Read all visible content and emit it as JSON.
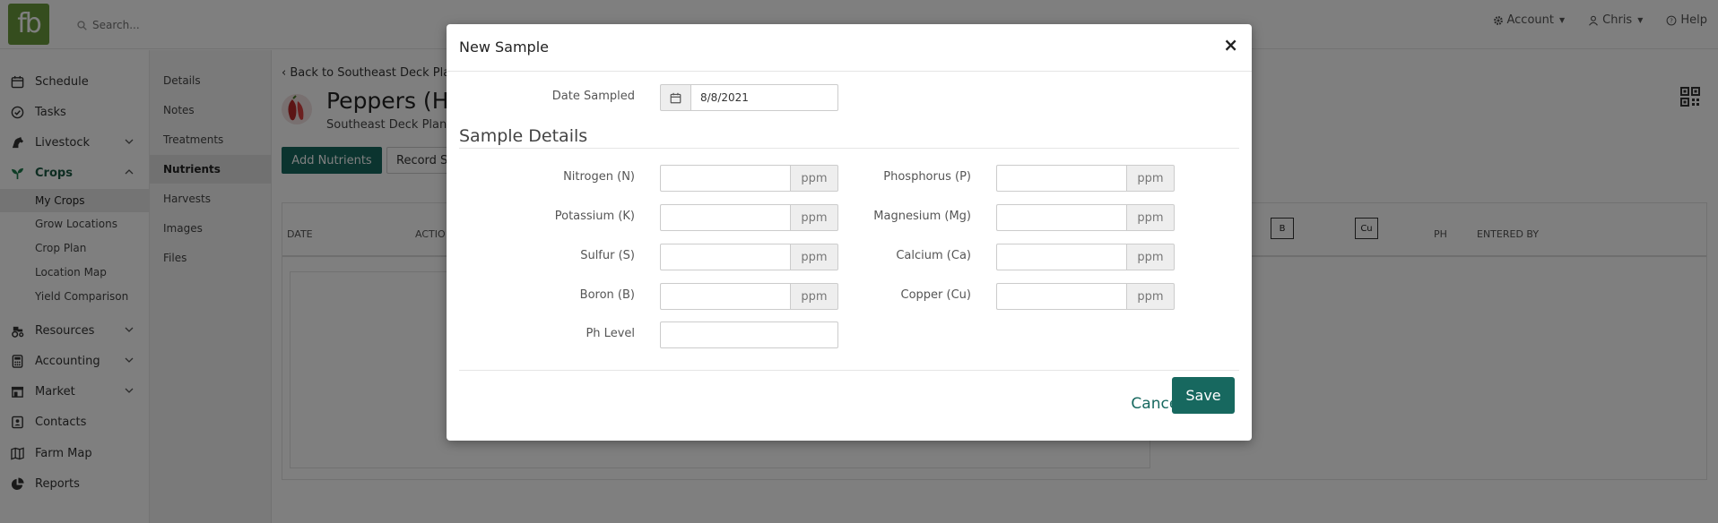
{
  "topbar": {
    "logo_text": "fb",
    "search_placeholder": "Search...",
    "account_label": "Account",
    "user_label": "Chris",
    "help_label": "Help"
  },
  "sidebar": {
    "items": [
      {
        "label": "Schedule",
        "icon": "calendar-icon"
      },
      {
        "label": "Tasks",
        "icon": "check-circle-icon"
      },
      {
        "label": "Livestock",
        "icon": "horse-icon"
      },
      {
        "label": "Crops",
        "icon": "seedling-icon"
      },
      {
        "label": "Resources",
        "icon": "tractor-icon"
      },
      {
        "label": "Accounting",
        "icon": "calculator-icon"
      },
      {
        "label": "Market",
        "icon": "store-icon"
      },
      {
        "label": "Contacts",
        "icon": "contact-card-icon"
      },
      {
        "label": "Farm Map",
        "icon": "map-icon"
      },
      {
        "label": "Reports",
        "icon": "pie-chart-icon"
      }
    ],
    "crop_subitems": [
      "My Crops",
      "Grow Locations",
      "Crop Plan",
      "Location Map",
      "Yield Comparison"
    ]
  },
  "subnav": {
    "items": [
      "Details",
      "Notes",
      "Treatments",
      "Nutrients",
      "Harvests",
      "Images",
      "Files"
    ]
  },
  "main": {
    "back_link": "Back to Southeast Deck Pla",
    "title": "Peppers (H",
    "subtitle": "Southeast Deck Plan",
    "add_button": "Add Nutrients",
    "record_button": "Record S",
    "columns": {
      "date": "DATE",
      "actions": "ACTIO",
      "boron": "B",
      "copper": "Cu",
      "ph": "PH",
      "entered_by": "ENTERED BY"
    }
  },
  "modal": {
    "title": "New Sample",
    "close": "×",
    "date_label": "Date Sampled",
    "date_value": "8/8/2021",
    "section_title": "Sample Details",
    "unit": "ppm",
    "fields_left": [
      "Nitrogen (N)",
      "Potassium (K)",
      "Sulfur (S)",
      "Boron (B)"
    ],
    "fields_right": [
      "Phosphorus (P)",
      "Magnesium (Mg)",
      "Calcium (Ca)",
      "Copper (Cu)"
    ],
    "ph_label": "Ph Level",
    "cancel": "Cancel",
    "save": "Save"
  },
  "colors": {
    "brand_green": "#17685f",
    "logo_green": "#6a9a3c",
    "overlay": "rgba(0,0,0,0.5)"
  }
}
